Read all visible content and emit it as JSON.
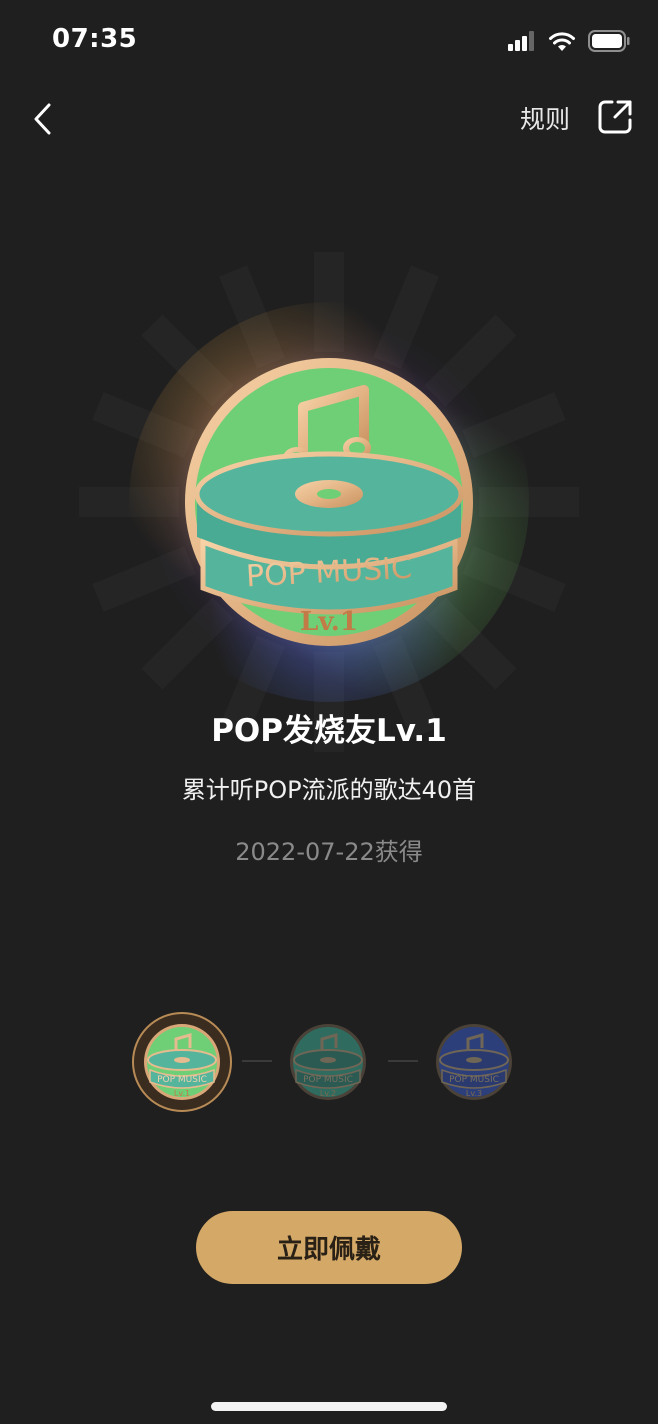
{
  "status_bar": {
    "time": "07:35"
  },
  "nav": {
    "rules_label": "规则"
  },
  "badge": {
    "ribbon_text": "POP MUSIC",
    "level_text": "Lv.1",
    "title": "POP发烧友Lv.1",
    "description": "累计听POP流派的歌达40首",
    "obtained_date": "2022-07-22获得"
  },
  "levels": [
    {
      "label": "Lv.1",
      "state": "selected",
      "color": "#6fcf76"
    },
    {
      "label": "Lv.2",
      "state": "locked",
      "color": "#2f6b5e"
    },
    {
      "label": "Lv.3",
      "state": "locked",
      "color": "#2d3f7a"
    }
  ],
  "actions": {
    "wear_label": "立即佩戴"
  },
  "colors": {
    "accent": "#d4a867",
    "background": "#1f1f1f"
  }
}
